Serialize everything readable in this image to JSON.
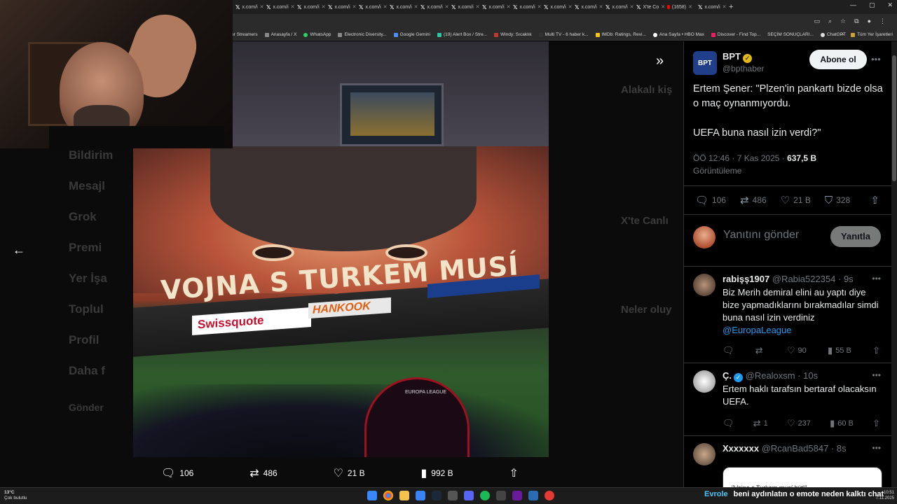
{
  "browser": {
    "tabs": [
      "x.com/i",
      "x.com/i",
      "x.com/i",
      "x.com/i",
      "x.com/i",
      "x.com/i",
      "x.com/i",
      "x.com/i",
      "x.com/i",
      "x.com/i",
      "x.com/i",
      "x.com/i",
      "x.com/i",
      "X'te Co",
      "(1658)",
      "x.com/i"
    ],
    "bookmarks": [
      "or Streamers",
      "Anasayfa / X",
      "WhatsApp",
      "Electronic Diversity...",
      "Google Gemini",
      "(19) Alert Box / Stre...",
      "Windy: Sıcaklık",
      "Multi TV - 6 haber k...",
      "IMDb: Ratings, Revi...",
      "Ana Sayfa • HBO Max",
      "Discover - Find Top...",
      "SEÇİM SONUÇLARI...",
      "ChatGPT"
    ],
    "bookmarks_overflow": "»",
    "bookmarks_folder": "Tüm Yer İşaretleri"
  },
  "background_page": {
    "nav": [
      "Bildirim",
      "Mesajl",
      "Grok",
      "Premi",
      "Yer İşa",
      "Toplul",
      "Profil",
      "Daha f"
    ],
    "post_button": "Gönder",
    "right_titles": [
      "Alakalı kiş",
      "X'te Canlı",
      "Neler oluy"
    ]
  },
  "photo": {
    "banner_text": "VOJNA S TURKEM MUSÍ BÝT!",
    "ad_1": "Swissquote",
    "ad_2": "HANKOOK",
    "arch_text": "EUROPA LEAGUE"
  },
  "viewer": {
    "back_icon": "arrow-left-icon",
    "collapse_icon": "double-chevron-right-icon",
    "replies": "106",
    "reposts": "486",
    "likes": "21 B",
    "views": "992 B"
  },
  "tweet": {
    "author_name": "BPT",
    "avatar_text": "BPT",
    "handle": "@bpthaber",
    "follow_label": "Abone ol",
    "text": "Ertem Şener: \"Plzen'in pankartı bizde olsa o maç oynanmıyordu.\n\nUEFA buna nasıl izin verdi?\"",
    "time": "ÖÖ 12:46 · 7 Kas 2025 · ",
    "views_count": "637,5 B",
    "views_label": "Görüntüleme",
    "stats": {
      "replies": "106",
      "reposts": "486",
      "likes": "21 B",
      "bookmarks": "328"
    },
    "reply_placeholder": "Yanıtını gönder",
    "reply_button": "Yanıtla"
  },
  "replies": [
    {
      "name": "rabişş1907",
      "handle": "@Rabia522354 · 9s",
      "text": "Biz Merih demiral elini au yaptı diye bize yapmadıklarını bırakmadılar simdi buna nasıl izin verdiniz ",
      "mention": "@EuropaLeague",
      "reposts": "",
      "likes": "90",
      "views": "55 B"
    },
    {
      "name": "Ç.",
      "handle": "@Realoxsm · 10s",
      "text": "Ertem haklı tarafsın bertaraf olacaksın UEFA.",
      "mention": "",
      "reposts": "1",
      "likes": "237",
      "views": "60 B"
    },
    {
      "name": "Xxxxxxx",
      "handle": "@RcanBad5847 · 8s",
      "quote_text": "\"Vojna s Turkem musí být!\""
    }
  ],
  "taskbar": {
    "temperature": "13°C",
    "weather": "Çok bulutlu",
    "ticker_highlight": "Evrole",
    "ticker_text": "beni aydınlatın o emote neden kalktı chat",
    "time": "10:51",
    "date": "7.11.2025"
  }
}
